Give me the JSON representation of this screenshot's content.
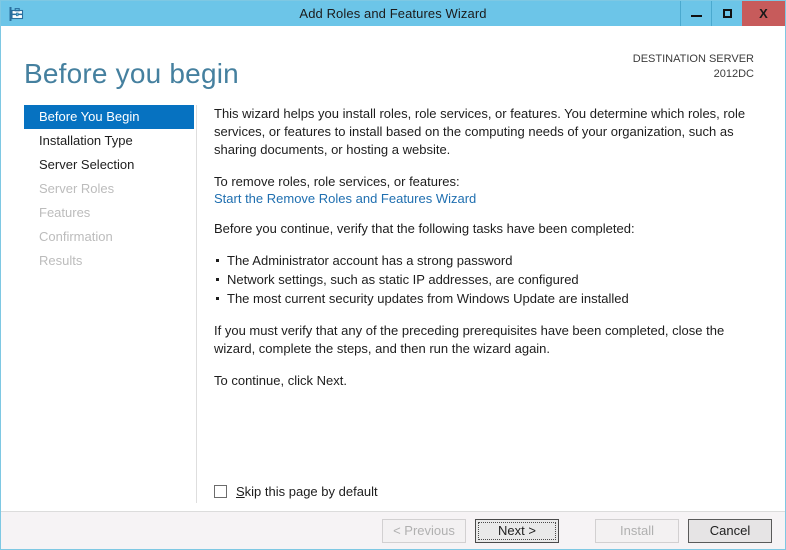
{
  "window": {
    "title": "Add Roles and Features Wizard",
    "icon": "server-toolbox-icon",
    "titlebar_color": "#6cc5e8",
    "close_color": "#c75b5b",
    "controls": {
      "minimize": "minimize-icon",
      "maximize": "maximize-icon",
      "close": "X"
    }
  },
  "header": {
    "page_title": "Before you begin",
    "destination_label": "DESTINATION SERVER",
    "destination_name": "2012DC",
    "title_color": "#45809f"
  },
  "sidebar": {
    "selected_color": "#0672c1",
    "items": [
      {
        "label": "Before You Begin",
        "state": "selected"
      },
      {
        "label": "Installation Type",
        "state": "enabled"
      },
      {
        "label": "Server Selection",
        "state": "enabled"
      },
      {
        "label": "Server Roles",
        "state": "disabled"
      },
      {
        "label": "Features",
        "state": "disabled"
      },
      {
        "label": "Confirmation",
        "state": "disabled"
      },
      {
        "label": "Results",
        "state": "disabled"
      }
    ]
  },
  "content": {
    "intro": "This wizard helps you install roles, role services, or features. You determine which roles, role services, or features to install based on the computing needs of your organization, such as sharing documents, or hosting a website.",
    "remove_prompt": "To remove roles, role services, or features:",
    "remove_link": "Start the Remove Roles and Features Wizard",
    "link_color": "#1f6fb0",
    "verify_prompt": "Before you continue, verify that the following tasks have been completed:",
    "tasks": [
      "The Administrator account has a strong password",
      "Network settings, such as static IP addresses, are configured",
      "The most current security updates from Windows Update are installed"
    ],
    "prereq_note": "If you must verify that any of the preceding prerequisites have been completed, close the wizard, complete the steps, and then run the wizard again.",
    "continue_note": "To continue, click Next.",
    "skip_checkbox": {
      "accel": "S",
      "label_rest": "kip this page by default",
      "checked": false
    }
  },
  "footer": {
    "buttons": [
      {
        "label": "< Previous",
        "state": "disabled",
        "name": "previous-button"
      },
      {
        "label": "Next >",
        "state": "default",
        "name": "next-button"
      },
      {
        "label": "Install",
        "state": "disabled",
        "name": "install-button"
      },
      {
        "label": "Cancel",
        "state": "enabled",
        "name": "cancel-button"
      }
    ]
  }
}
